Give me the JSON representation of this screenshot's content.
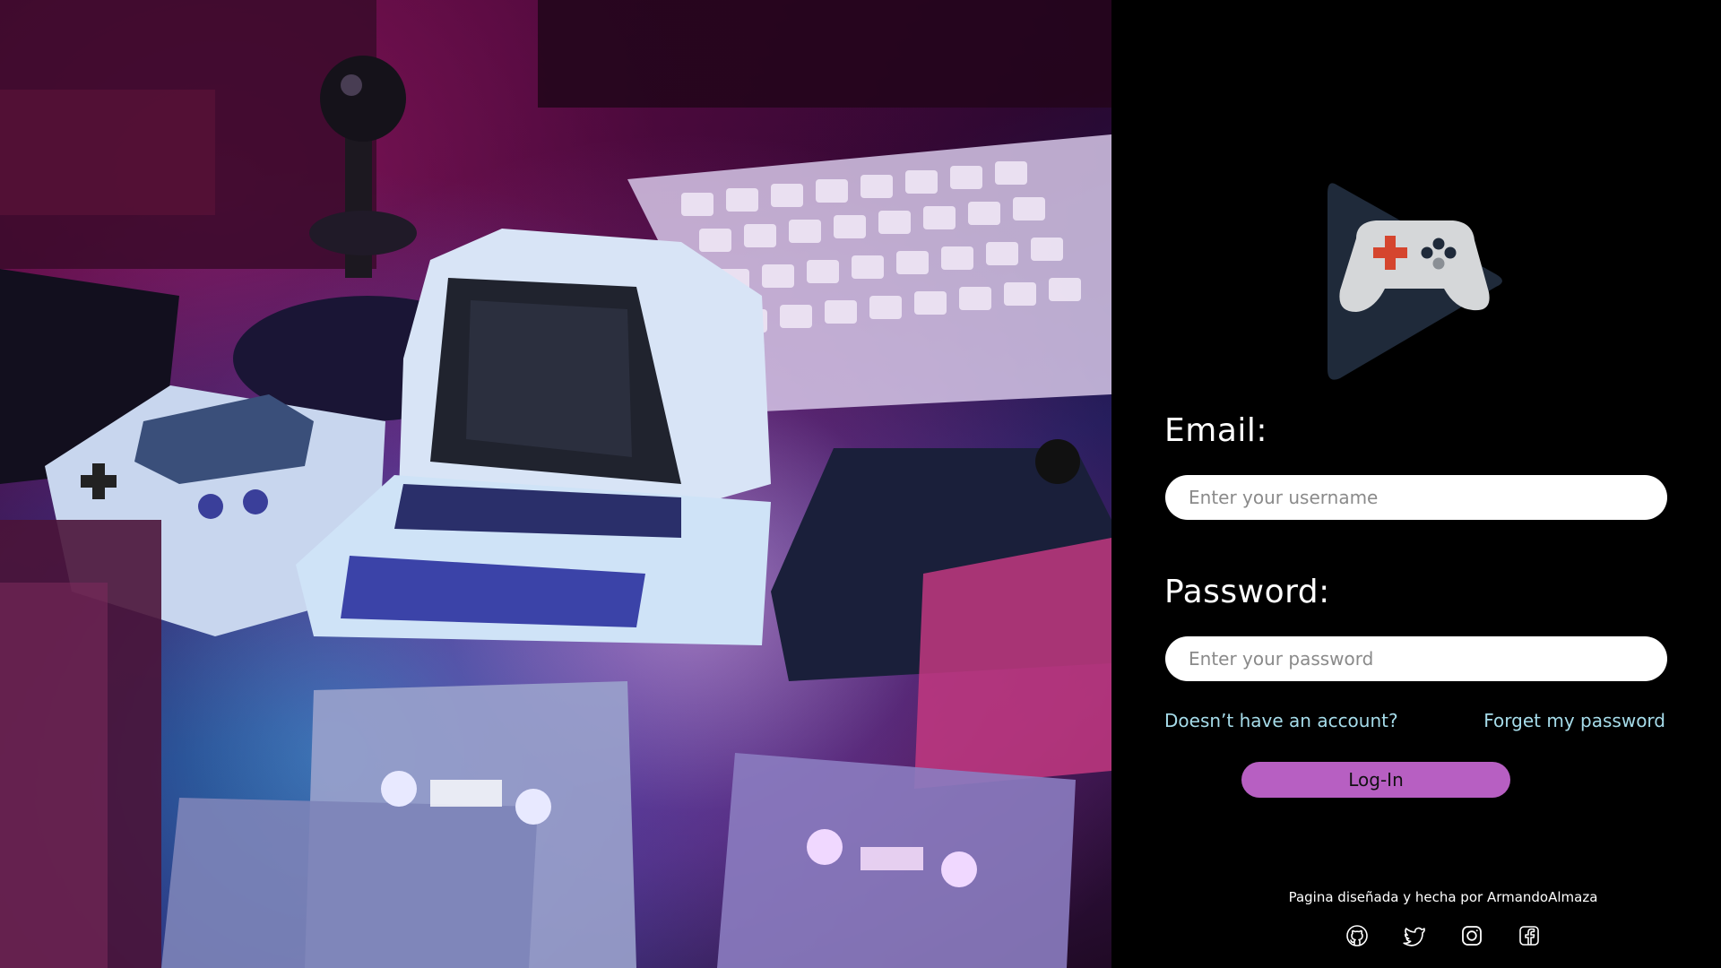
{
  "colors": {
    "panel_background": "#000000",
    "input_background": "#ffffff",
    "link": "#a6dcea",
    "login_button": "#b75fc2",
    "logo_triangle": "#1f2a3a",
    "logo_controller": "#d5d7d9",
    "logo_dpad": "#d5452e"
  },
  "hero": {
    "icon": "retro-computers-photo"
  },
  "logo": {
    "icon": "game-controller-play-logo"
  },
  "form": {
    "email_label": "Email:",
    "email_placeholder": "Enter your username",
    "email_value": "",
    "password_label": "Password:",
    "password_placeholder": "Enter your password",
    "password_value": "",
    "signup_link": "Doesn’t have an account?",
    "forgot_link": "Forget my password",
    "login_button": "Log-In"
  },
  "footer": {
    "credit": "Pagina diseñada y hecha por ArmandoAlmaza",
    "social": [
      {
        "icon": "github-icon"
      },
      {
        "icon": "twitter-icon"
      },
      {
        "icon": "instagram-icon"
      },
      {
        "icon": "facebook-icon"
      }
    ]
  }
}
